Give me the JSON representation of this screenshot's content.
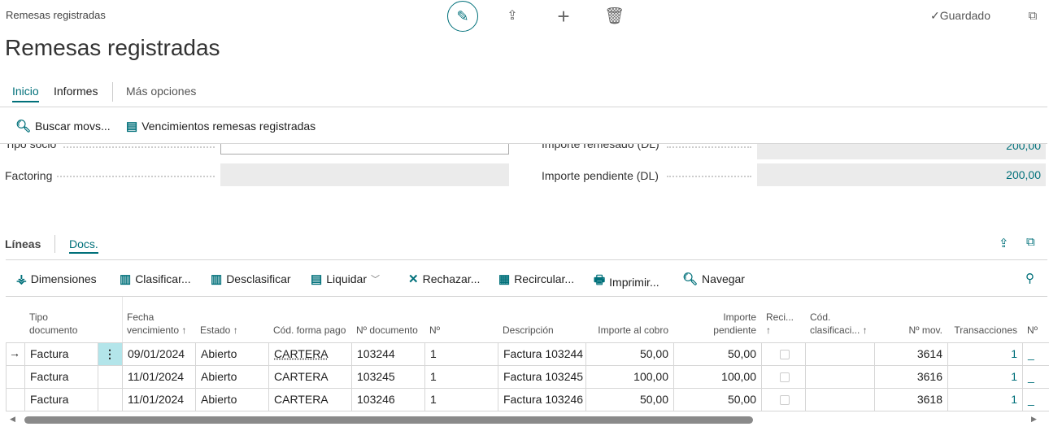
{
  "header": {
    "breadcrumb": "Remesas registradas",
    "saved_status": "Guardado",
    "title": "Remesas registradas"
  },
  "tabs": [
    {
      "label": "Inicio",
      "active": true
    },
    {
      "label": "Informes"
    },
    {
      "label": "Más opciones"
    }
  ],
  "actions": [
    {
      "label": "Buscar movs...",
      "icon": "find-entries-icon"
    },
    {
      "label": "Vencimientos remesas registradas",
      "icon": "due-dates-icon"
    }
  ],
  "form": {
    "left": [
      {
        "label": "Tipo socio",
        "value": ""
      },
      {
        "label": "Factoring",
        "value": ""
      }
    ],
    "right": [
      {
        "label": "Importe remesado (DL)",
        "value": "200,00"
      },
      {
        "label": "Importe pendiente (DL)",
        "value": "200,00"
      }
    ]
  },
  "lines": {
    "tabs": [
      {
        "label": "Líneas"
      },
      {
        "label": "Docs.",
        "active": true
      }
    ],
    "toolbar": [
      {
        "label": "Dimensiones",
        "icon": "dimensions-icon"
      },
      {
        "label": "Clasificar...",
        "icon": "categorize-icon"
      },
      {
        "label": "Desclasificar",
        "icon": "uncategorize-icon"
      },
      {
        "label": "Liquidar",
        "icon": "settle-icon"
      },
      {
        "label": "Rechazar...",
        "icon": "reject-icon"
      },
      {
        "label": "Recircular...",
        "icon": "redraw-icon"
      },
      {
        "label": "Imprimir...",
        "icon": "print-icon"
      },
      {
        "label": "Navegar",
        "icon": "navigate-icon"
      }
    ],
    "columns": [
      "Tipo documento",
      "Fecha vencimiento ↑",
      "Estado ↑",
      "Cód. forma pago",
      "Nº documento",
      "Nº",
      "Descripción",
      "Importe al cobro",
      "Importe pendiente",
      "Reci... ↑",
      "Cód. clasificaci... ↑",
      "Nº mov.",
      "Transacciones",
      "Nº"
    ],
    "rows": [
      {
        "tipo": "Factura",
        "fecha": "09/01/2024",
        "estado": "Abierto",
        "forma": "CARTERA",
        "doc": "103244",
        "no": "1",
        "desc": "Factura 103244",
        "cobro": "50,00",
        "pend": "50,00",
        "reci": false,
        "clasif": "",
        "mov": "3614",
        "trans": "1",
        "last": "_"
      },
      {
        "tipo": "Factura",
        "fecha": "11/01/2024",
        "estado": "Abierto",
        "forma": "CARTERA",
        "doc": "103245",
        "no": "1",
        "desc": "Factura 103245",
        "cobro": "100,00",
        "pend": "100,00",
        "reci": false,
        "clasif": "",
        "mov": "3616",
        "trans": "1",
        "last": "_"
      },
      {
        "tipo": "Factura",
        "fecha": "11/01/2024",
        "estado": "Abierto",
        "forma": "CARTERA",
        "doc": "103246",
        "no": "1",
        "desc": "Factura 103246",
        "cobro": "50,00",
        "pend": "50,00",
        "reci": false,
        "clasif": "",
        "mov": "3618",
        "trans": "1",
        "last": "_"
      }
    ]
  },
  "colors": {
    "accent": "#00707a",
    "selected_cell": "#b3e5ea"
  }
}
